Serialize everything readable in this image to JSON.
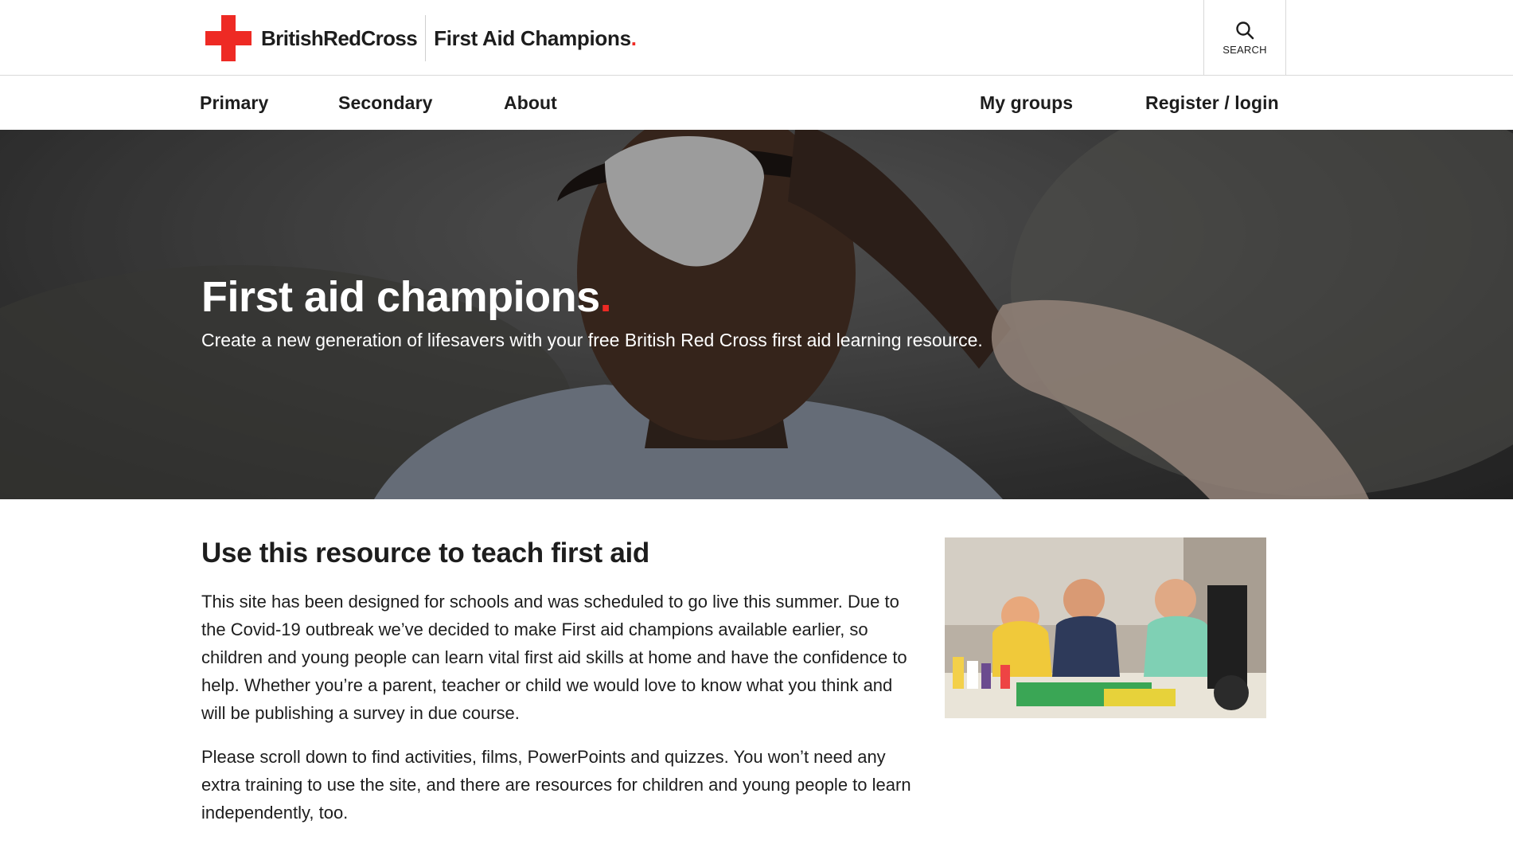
{
  "header": {
    "brand": "BritishRedCross",
    "site_name": "First Aid Champions",
    "site_name_dot": ".",
    "search_label": "SEARCH",
    "accent": "#ee2a24"
  },
  "nav": {
    "primary": "Primary",
    "secondary": "Secondary",
    "about": "About",
    "my_groups": "My groups",
    "register_login": "Register / login"
  },
  "hero": {
    "title": "First aid champions",
    "title_dot": ".",
    "subtitle": "Create a new generation of lifesavers with your free British Red Cross first aid learning resource."
  },
  "main": {
    "heading": "Use this resource to teach first aid",
    "paragraph1": "This site has been designed for schools and was scheduled to go live this summer. Due to the Covid-19 outbreak we’ve decided to make First aid champions available earlier, so children and young people can learn vital first aid skills at home and have the confidence to help. Whether you’re a parent, teacher or child we would love to know what you think and will be publishing a survey in due course.",
    "paragraph2": "Please scroll down to find activities, films, PowerPoints and quizzes. You won’t need any extra training to use the site, and there are resources for children and young people to learn independently, too."
  },
  "icons": {
    "search": "search-icon",
    "logo": "red-cross-icon"
  }
}
